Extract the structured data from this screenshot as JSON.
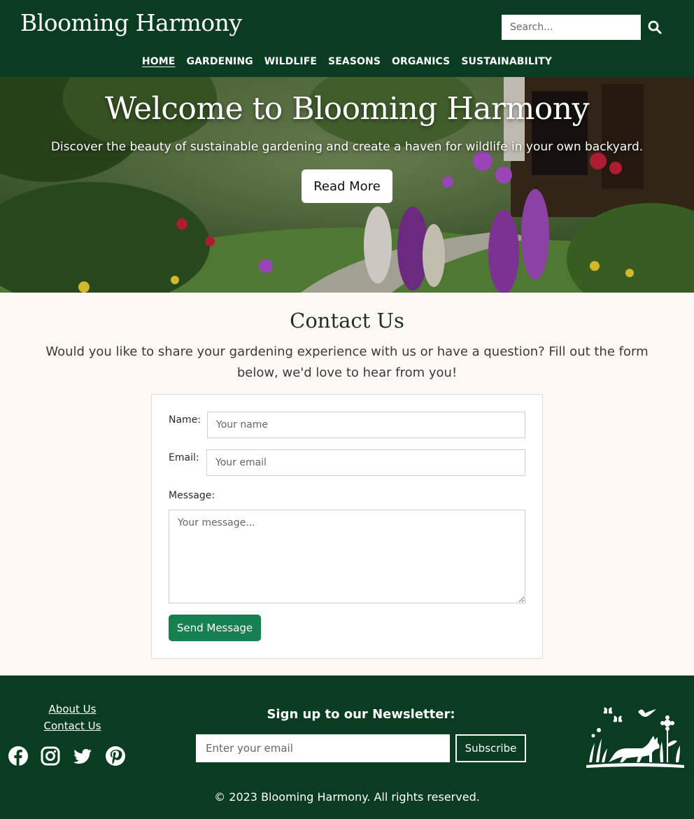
{
  "header": {
    "logo": "Blooming Harmony",
    "search_placeholder": "Search...",
    "nav": [
      {
        "label": "HOME",
        "active": true
      },
      {
        "label": "GARDENING"
      },
      {
        "label": "WILDLIFE"
      },
      {
        "label": "SEASONS"
      },
      {
        "label": "ORGANICS"
      },
      {
        "label": "SUSTAINABILITY"
      }
    ]
  },
  "hero": {
    "title": "Welcome to Blooming Harmony",
    "subtitle": "Discover the beauty of sustainable gardening and create a haven for wildlife in your own backyard.",
    "button_label": "Read More"
  },
  "contact": {
    "title": "Contact Us",
    "description": "Would you like to share your gardening experience with us or have a question? Fill out the form below, we'd love to hear from you!",
    "name_label": "Name:",
    "name_placeholder": "Your name",
    "email_label": "Email:",
    "email_placeholder": "Your email",
    "message_label": "Message:",
    "message_placeholder": "Your message...",
    "send_label": "Send Message"
  },
  "footer": {
    "links": [
      "About Us",
      "Contact Us"
    ],
    "social_icons": [
      "facebook-icon",
      "instagram-icon",
      "twitter-icon",
      "pinterest-icon"
    ],
    "newsletter_title": "Sign up to our Newsletter:",
    "newsletter_placeholder": "Enter your email",
    "subscribe_label": "Subscribe",
    "copyright": "© 2023 Blooming Harmony. All rights reserved."
  },
  "colors": {
    "brand_green": "#0a3c22",
    "button_green": "#168050",
    "page_bg": "#fdf8f4"
  }
}
